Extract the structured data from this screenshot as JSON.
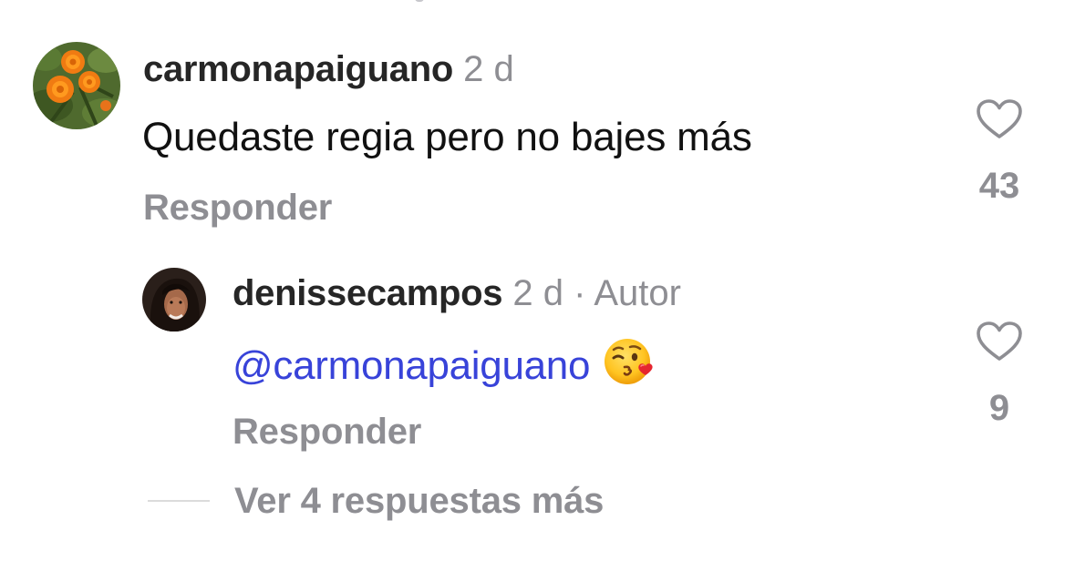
{
  "comments": [
    {
      "username": "carmonapaiguano",
      "time": "2 d",
      "text": "Quedaste regia pero no bajes más",
      "reply_label": "Responder",
      "like_count": "43",
      "avatar": "marigold-flowers-avatar",
      "icon": "heart-outline-icon"
    },
    {
      "username": "denissecampos",
      "time": "2 d",
      "separator": "·",
      "author_badge": "Autor",
      "mention": "@carmonapaiguano",
      "emoji": "face-blowing-a-kiss",
      "reply_label": "Responder",
      "like_count": "9",
      "avatar": "woman-portrait-avatar",
      "icon": "heart-outline-icon"
    }
  ],
  "view_more_label": "Ver 4 respuestas más",
  "colors": {
    "username": "#262626",
    "meta": "#8e8e93",
    "mention": "#3843d9",
    "divider": "#dbdbdb"
  }
}
